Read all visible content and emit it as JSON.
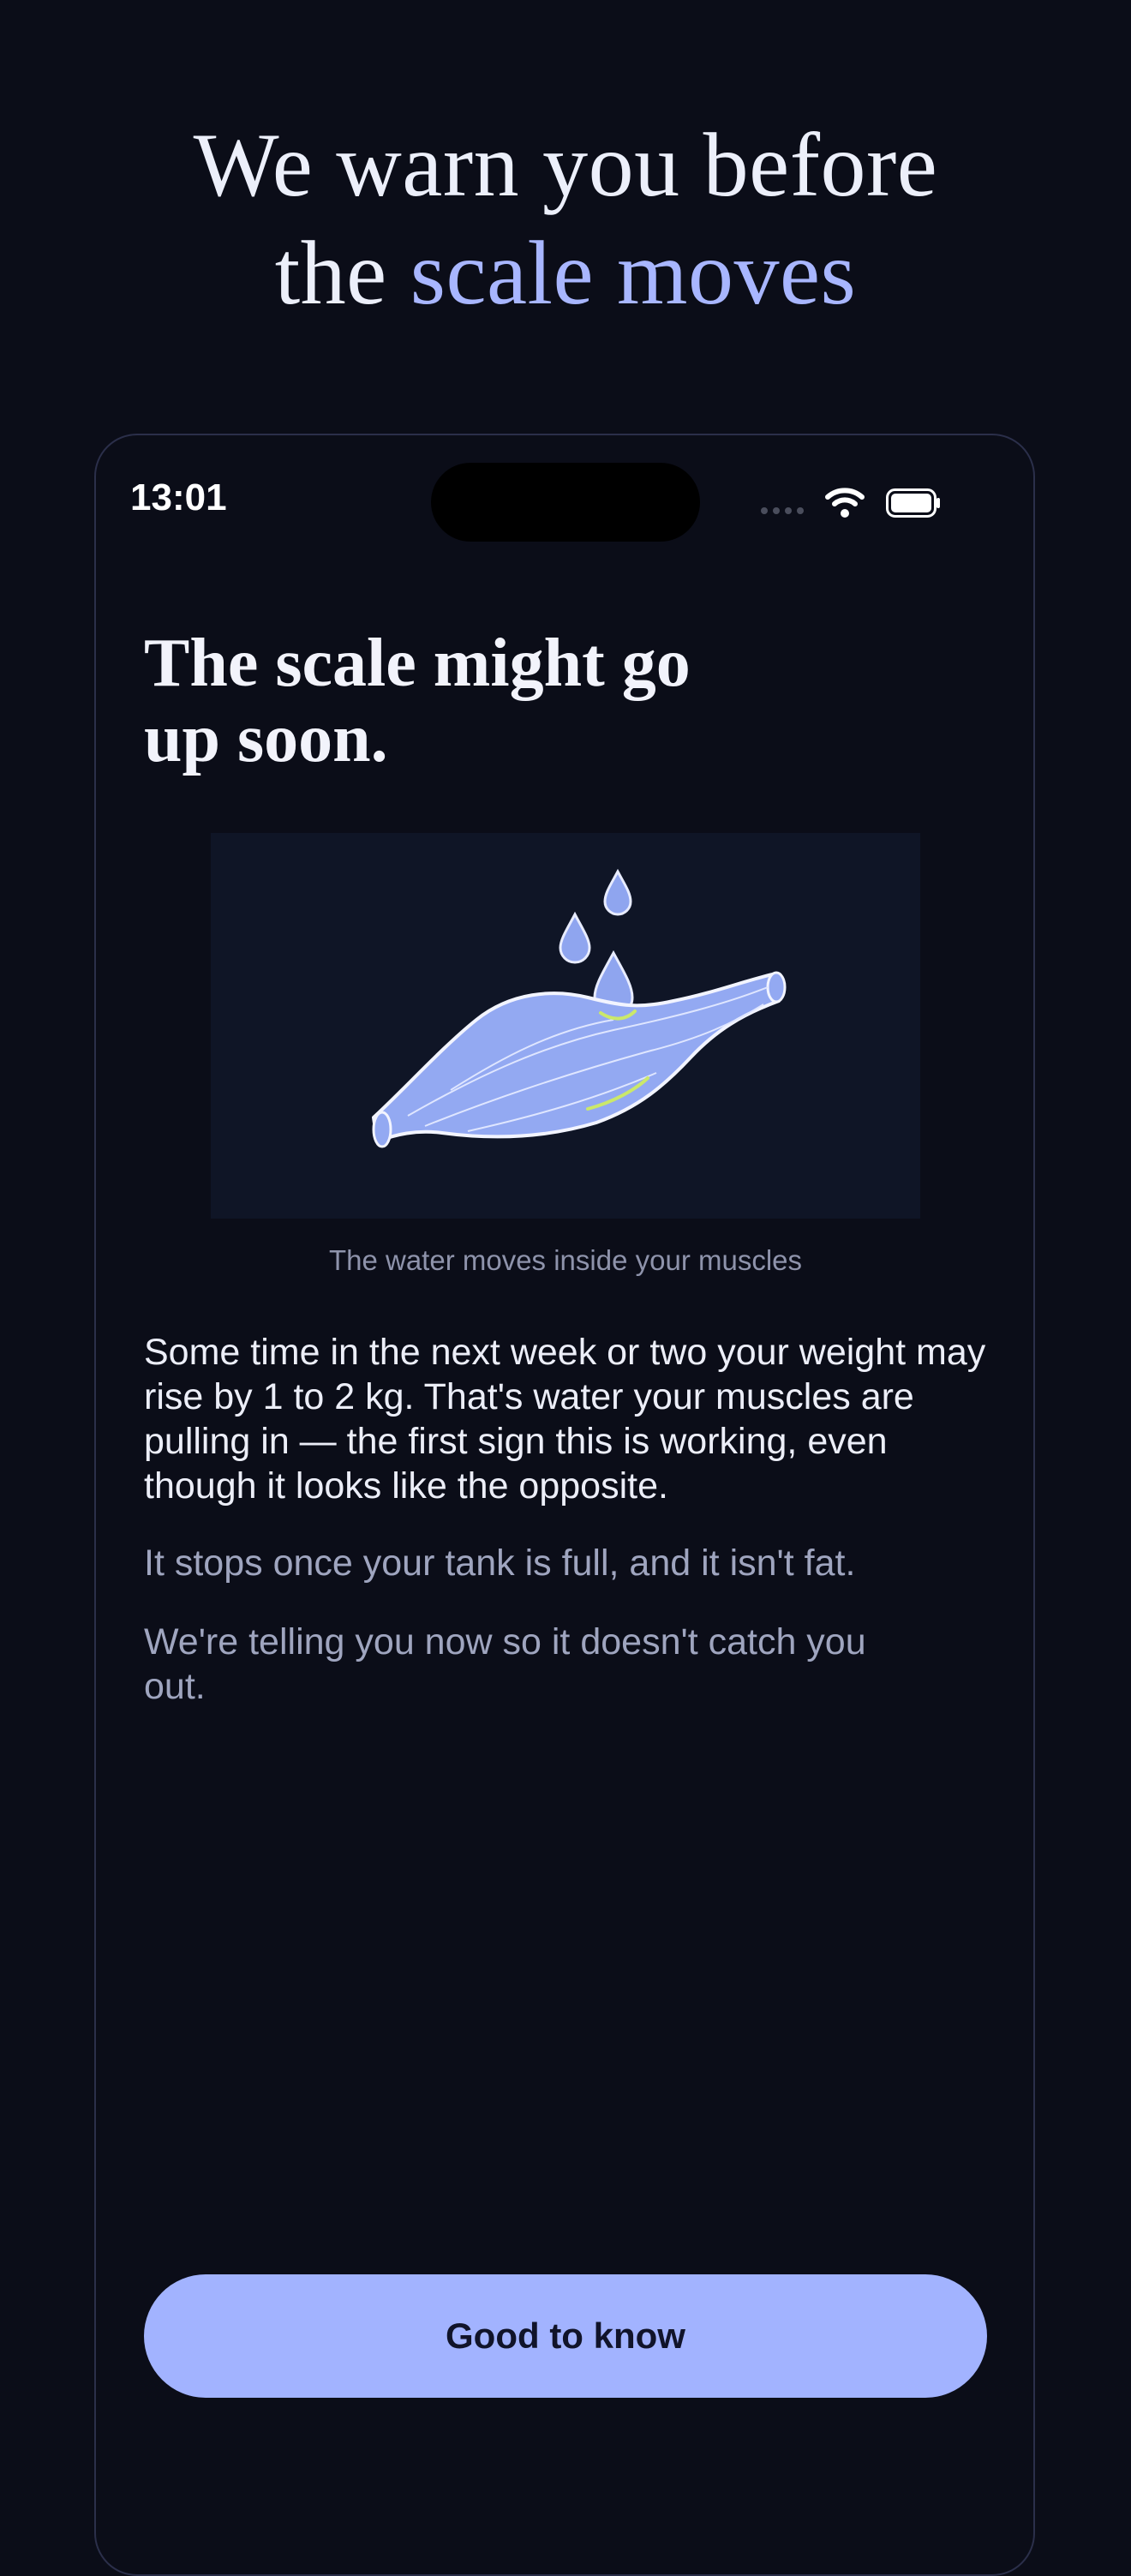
{
  "marketing": {
    "headline_line1": "We warn you before",
    "headline_prefix": "the ",
    "headline_accent": "scale moves"
  },
  "status_bar": {
    "time": "13:01",
    "icons": [
      "signal-dots-icon",
      "wifi-icon",
      "battery-icon"
    ]
  },
  "screen": {
    "title_line1": "The scale might go",
    "title_line2": "up soon.",
    "illustration": "muscle-with-water-drops",
    "caption": "The water moves inside your muscles",
    "body_main": "Some time in the next week or two your weight may rise by 1 to 2 kg. That's water your muscles are pulling in — the first sign this is working, even though it looks like the opposite.",
    "body_sub1": "It stops once your tank is full, and it isn't fat.",
    "body_sub2": "We're telling you now so it doesn't catch you out.",
    "cta_label": "Good to know"
  },
  "colors": {
    "background": "#0b0d18",
    "accent": "#a8b6ff",
    "button": "#a2b3ff",
    "muted_text": "#9fa5bf"
  }
}
